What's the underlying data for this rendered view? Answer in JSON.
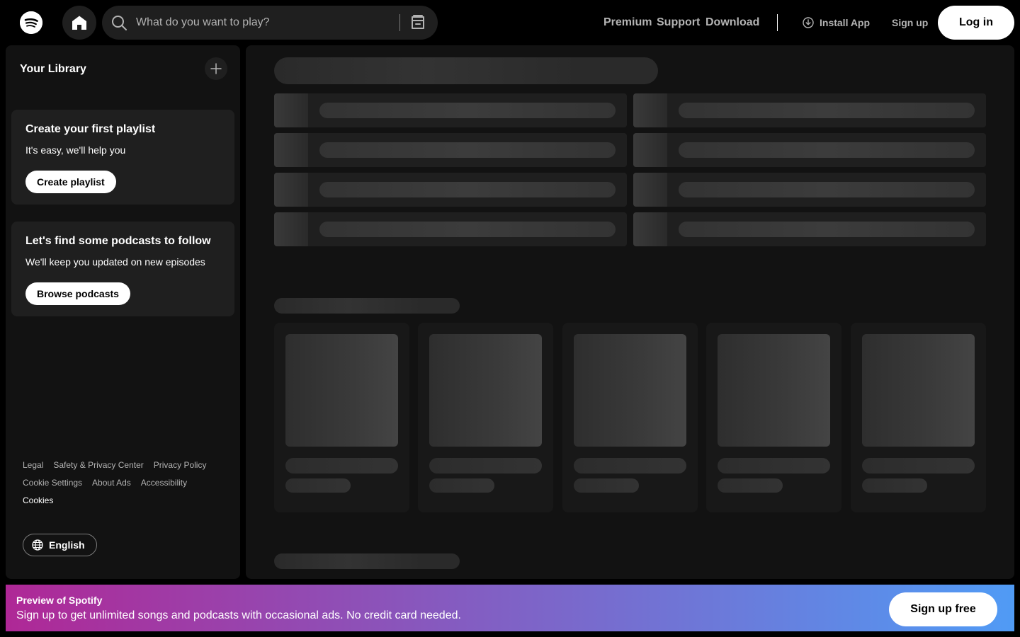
{
  "header": {
    "logo_icon": "spotify-logo-icon",
    "home_icon": "home-icon",
    "search": {
      "placeholder": "What do you want to play?",
      "icon": "search-icon",
      "browse_icon": "browse-icon"
    },
    "nav": {
      "premium": "Premium",
      "support": "Support",
      "download": "Download"
    },
    "install_app": "Install App",
    "sign_up": "Sign up",
    "log_in": "Log in"
  },
  "sidebar": {
    "title": "Your Library",
    "add_icon": "plus-icon",
    "playlist_promo": {
      "title": "Create your first playlist",
      "subtitle": "It's easy, we'll help you",
      "button": "Create playlist"
    },
    "podcast_promo": {
      "title": "Let's find some podcasts to follow",
      "subtitle": "We'll keep you updated on new episodes",
      "button": "Browse podcasts"
    },
    "legal_links": {
      "row1": [
        "Legal",
        "Safety & Privacy Center",
        "Privacy Policy"
      ],
      "row2": [
        "Cookie Settings",
        "About Ads",
        "Accessibility"
      ],
      "row3": [
        "Cookies"
      ]
    },
    "language": "English",
    "language_icon": "globe-icon"
  },
  "banner": {
    "title": "Preview of Spotify",
    "subtitle": "Sign up to get unlimited songs and podcasts with occasional ads. No credit card needed.",
    "button": "Sign up free",
    "gradient_start": "#af2896",
    "gradient_end": "#509bf5"
  },
  "colors": {
    "background": "#000000",
    "panel": "#121212",
    "surface": "#1f1f1f",
    "muted_text": "#b3b3b3"
  }
}
